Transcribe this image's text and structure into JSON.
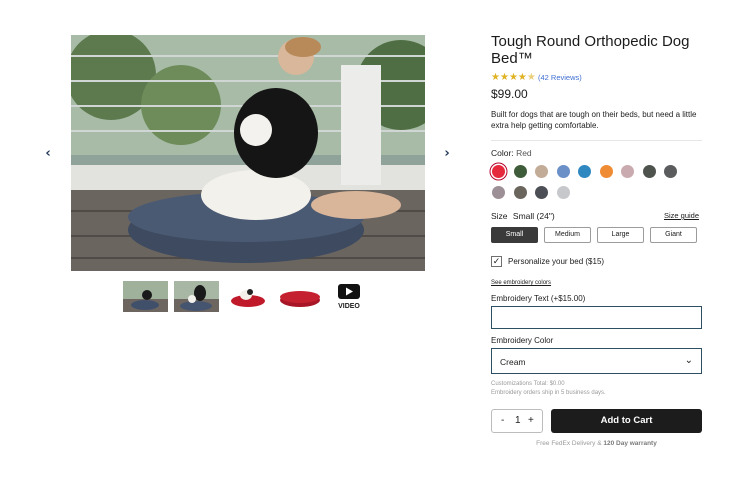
{
  "gallery": {
    "prev_icon": "chevron-left-icon",
    "next_icon": "chevron-right-icon",
    "video_label": "VIDEO",
    "thumbnails": [
      "photo-deck",
      "photo-woman-dog",
      "photo-dog-red-bed",
      "photo-red-bed",
      "video-play-icon"
    ]
  },
  "product": {
    "title": "Tough Round Orthopedic Dog Bed™",
    "rating_stars": 4.5,
    "reviews": "(42 Reviews)",
    "price": "$99.00",
    "description": "Built for dogs that are tough on their beds, but need a little extra help getting comfortable."
  },
  "color": {
    "label": "Color:",
    "selected": "Red",
    "swatches": [
      "#e5283b",
      "#3e5c39",
      "#c2ab97",
      "#6b8fc7",
      "#2f88c0",
      "#ef8c33",
      "#c9aaae",
      "#4f534e",
      "#5b5c5d",
      "#9d8f96",
      "#6a665d",
      "#4c4f56",
      "#c6c8cb"
    ]
  },
  "size": {
    "label": "Size",
    "selected": "Small (24\")",
    "guide": "Size guide",
    "options": [
      "Small",
      "Medium",
      "Large",
      "Giant"
    ]
  },
  "personalize": {
    "checked": true,
    "label": "Personalize your bed ($15)",
    "colors_link": "See embroidery colors",
    "text_label": "Embroidery Text (+$15.00)",
    "text_value": "",
    "color_label": "Embroidery Color",
    "color_value": "Cream",
    "total": "Customizations Total: $0.00",
    "ship_note": "Embroidery orders ship in 5 business days."
  },
  "cart": {
    "minus": "-",
    "qty": "1",
    "plus": "+",
    "button": "Add to Cart",
    "delivery_prefix": "Free FedEx Delivery &",
    "delivery_bold": "120 Day warranty"
  }
}
